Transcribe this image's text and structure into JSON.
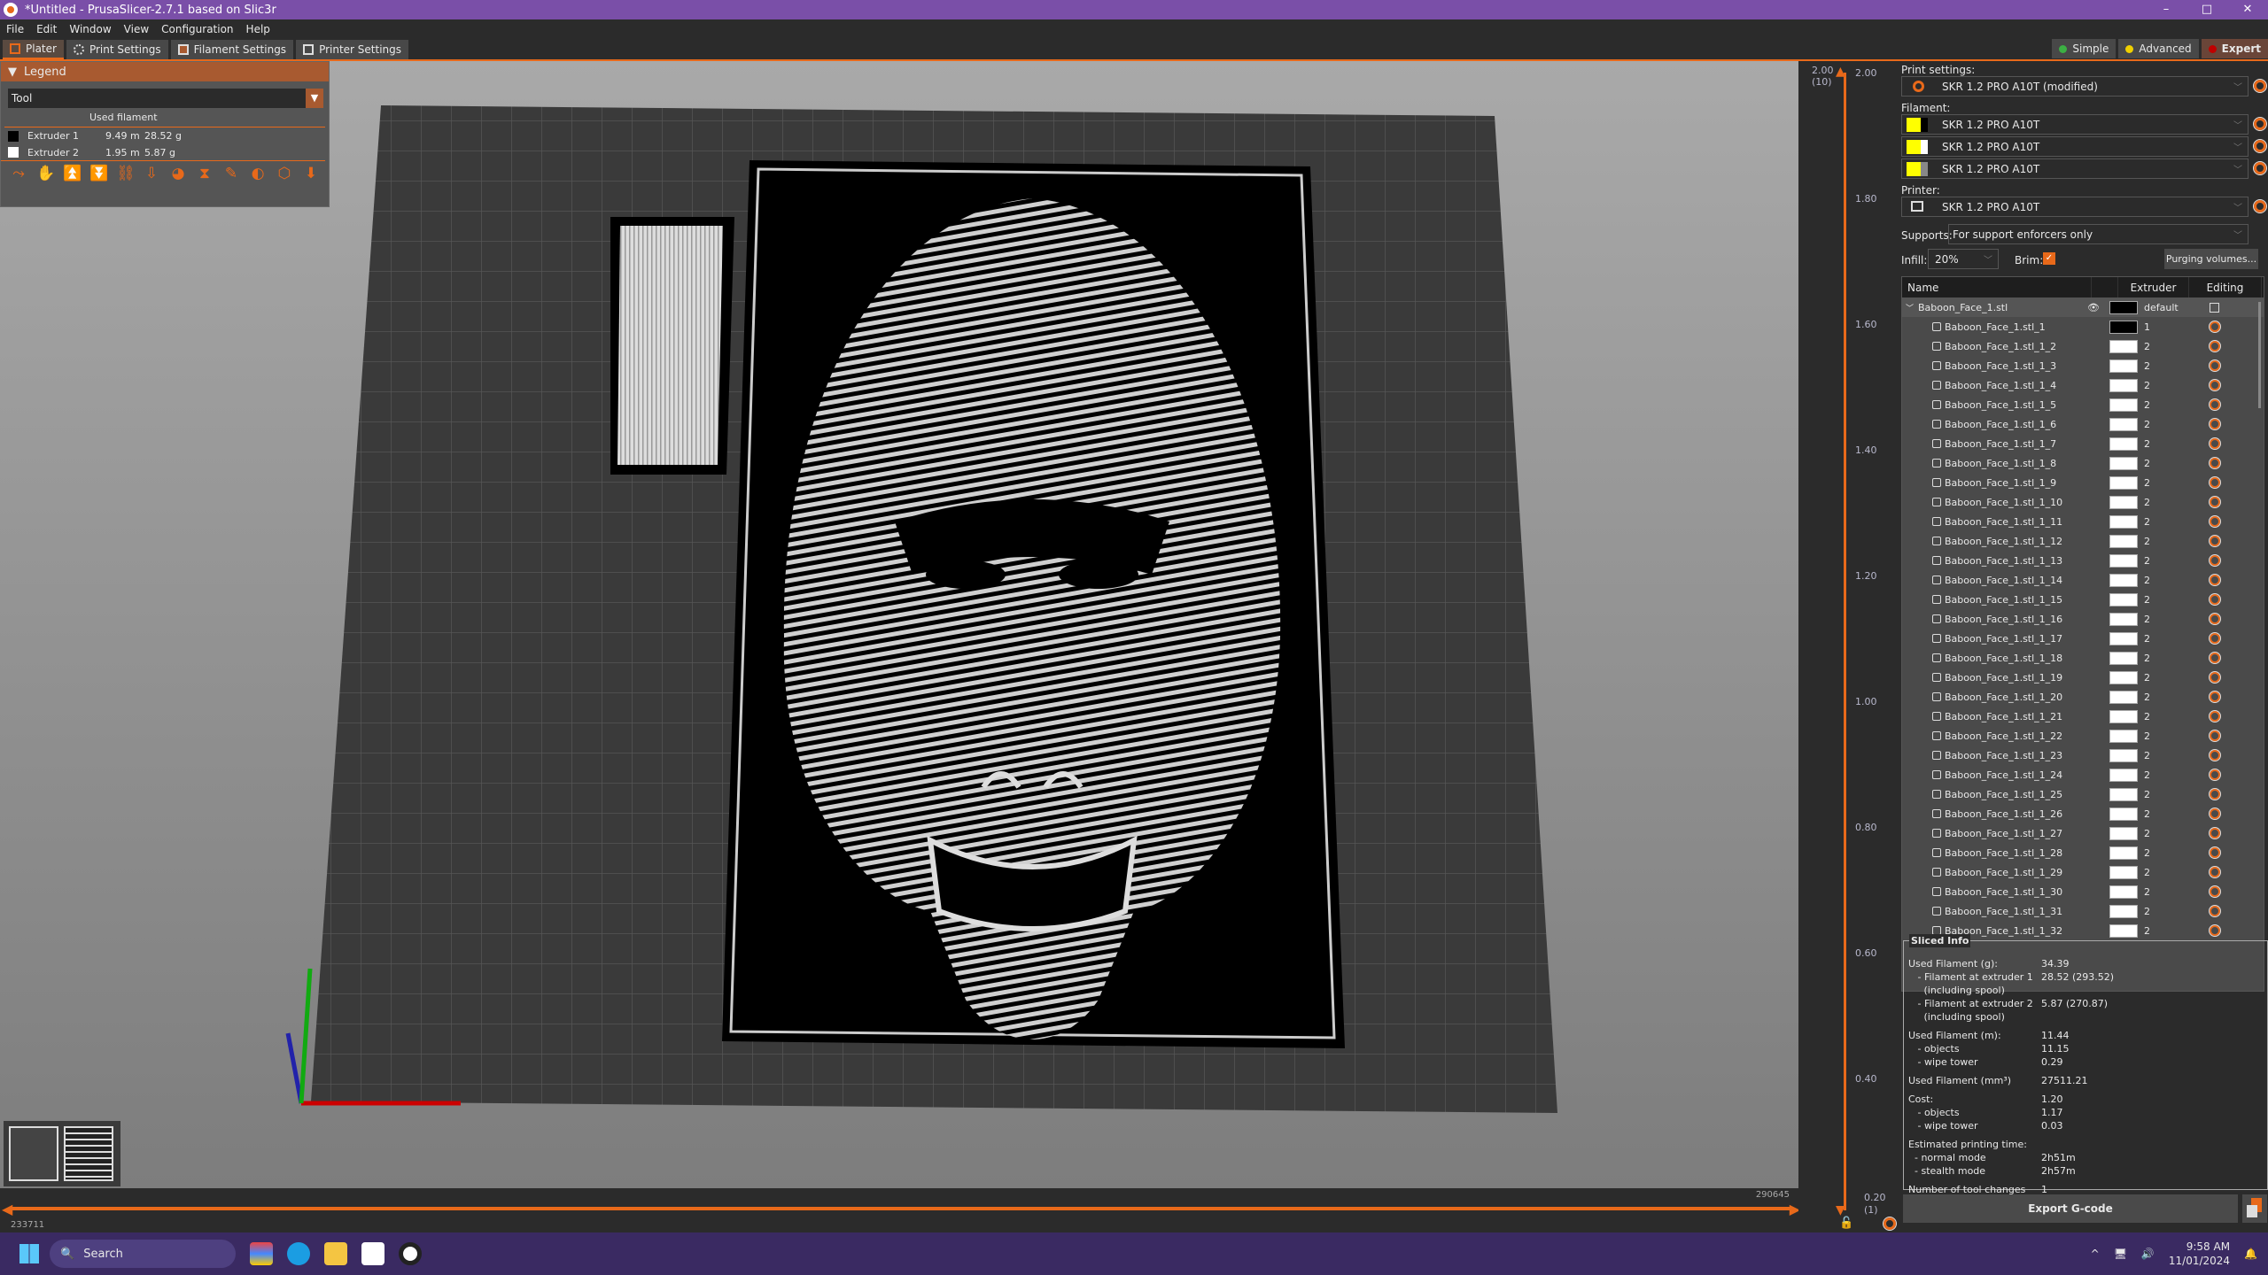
{
  "window": {
    "title": "*Untitled - PrusaSlicer-2.7.1 based on Slic3r",
    "minimize": "–",
    "maximize": "□",
    "close": "✕"
  },
  "menu": [
    "File",
    "Edit",
    "Window",
    "View",
    "Configuration",
    "Help"
  ],
  "tabs": [
    {
      "label": "Plater",
      "icon": "plater-icon"
    },
    {
      "label": "Print Settings",
      "icon": "gear-icon"
    },
    {
      "label": "Filament Settings",
      "icon": "spool-icon"
    },
    {
      "label": "Printer Settings",
      "icon": "printer-icon"
    }
  ],
  "modes": [
    {
      "label": "Simple",
      "color": "#3cb043"
    },
    {
      "label": "Advanced",
      "color": "#f0d000"
    },
    {
      "label": "Expert",
      "color": "#c00000"
    }
  ],
  "legend": {
    "title": "Legend",
    "view_type": "Tool",
    "column": "Used filament",
    "rows": [
      {
        "name": "Extruder 1",
        "length": "9.49 m",
        "weight": "28.52 g",
        "color": "#000000"
      },
      {
        "name": "Extruder 2",
        "length": "1.95 m",
        "weight": "5.87 g",
        "color": "#ffffff"
      }
    ],
    "tools": [
      "travel-icon",
      "wipe-icon",
      "retractions-icon",
      "deretractions-icon",
      "seams-icon",
      "tool-changes-icon",
      "color-changes-icon",
      "pause-icon",
      "custom-gcode-icon",
      "center-of-gravity-icon",
      "shells-icon",
      "tool-marker-icon"
    ]
  },
  "hslider": {
    "low": "233711",
    "high": "290645"
  },
  "vslider": {
    "top": "2.00",
    "top_layer": "(10)",
    "top_right": "2.00",
    "bottom": "0.20",
    "bottom_layer": "(1)",
    "ticks": [
      "1.80",
      "1.60",
      "1.40",
      "1.20",
      "1.00",
      "0.80",
      "0.60",
      "0.40"
    ]
  },
  "sidebar": {
    "print_label": "Print settings:",
    "print_value": "SKR 1.2 PRO A10T (modified)",
    "filament_label": "Filament:",
    "filaments": [
      {
        "value": "SKR 1.2 PRO A10T",
        "color": "#000000"
      },
      {
        "value": "SKR 1.2 PRO A10T",
        "color": "#ffffff"
      },
      {
        "value": "SKR 1.2 PRO A10T",
        "color": "#888888"
      }
    ],
    "printer_label": "Printer:",
    "printer_value": "SKR 1.2 PRO A10T",
    "supports_label": "Supports:",
    "supports_value": "For support enforcers only",
    "infill_label": "Infill:",
    "infill_value": "20%",
    "brim_label": "Brim:",
    "brim_checked": true,
    "purging_button": "Purging volumes...",
    "columns": {
      "name": "Name",
      "extruder": "Extruder",
      "editing": "Editing"
    },
    "object": {
      "name": "Baboon_Face_1.stl",
      "extruder": "default"
    },
    "parts_prefix": "Baboon_Face_1.stl_1_",
    "first_part": {
      "name": "Baboon_Face_1.stl_1",
      "extruder": "1"
    },
    "part_extruder": "2",
    "part_count": 32
  },
  "sliced_info": {
    "title": "Sliced Info",
    "rows": [
      {
        "k": "Used Filament (g):",
        "v": "34.39"
      },
      {
        "k": "   - Filament at extruder 1",
        "v": "28.52 (293.52)"
      },
      {
        "k": "     (including spool)",
        "v": ""
      },
      {
        "k": "   - Filament at extruder 2",
        "v": "5.87 (270.87)"
      },
      {
        "k": "     (including spool)",
        "v": ""
      },
      {
        "gap": true
      },
      {
        "k": "Used Filament (m):",
        "v": "11.44"
      },
      {
        "k": "   - objects",
        "v": "11.15"
      },
      {
        "k": "   - wipe tower",
        "v": "0.29"
      },
      {
        "gap": true
      },
      {
        "k": "Used Filament (mm³)",
        "v": "27511.21"
      },
      {
        "gap": true
      },
      {
        "k": "Cost:",
        "v": "1.20"
      },
      {
        "k": "   - objects",
        "v": "1.17"
      },
      {
        "k": "   - wipe tower",
        "v": "0.03"
      },
      {
        "gap": true
      },
      {
        "k": "Estimated printing time:",
        "v": ""
      },
      {
        "k": "  - normal mode",
        "v": "2h51m"
      },
      {
        "k": "  - stealth mode",
        "v": "2h57m"
      },
      {
        "gap": true
      },
      {
        "k": "Number of tool changes",
        "v": "1"
      }
    ]
  },
  "export_button": "Export G-code",
  "taskbar": {
    "search": "Search",
    "time": "9:58 AM",
    "date": "11/01/2024"
  }
}
